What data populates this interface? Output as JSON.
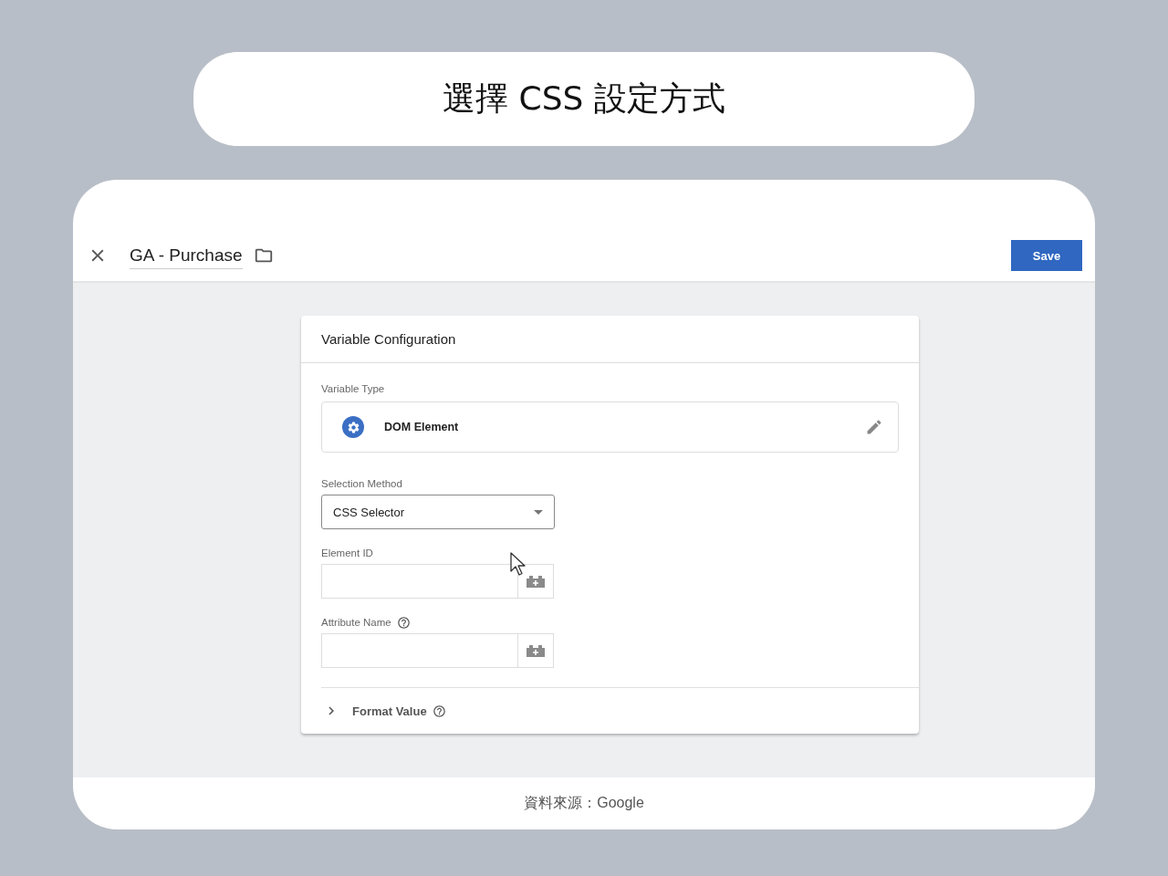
{
  "slide_title": "選擇 CSS 設定方式",
  "editor": {
    "title": "GA - Purchase",
    "save_button": "Save"
  },
  "panel": {
    "title": "Variable Configuration",
    "variable_type": {
      "label": "Variable Type",
      "value": "DOM Element"
    },
    "fields": [
      {
        "kind": "select",
        "label": "Selection Method",
        "value": "CSS Selector",
        "help": false
      },
      {
        "kind": "variable-input",
        "label": "Element ID",
        "help": false
      },
      {
        "kind": "variable-input",
        "label": "Attribute Name",
        "help": true
      }
    ],
    "format_value": {
      "label": "Format Value",
      "expanded": false
    }
  },
  "source": "資料來源：Google"
}
